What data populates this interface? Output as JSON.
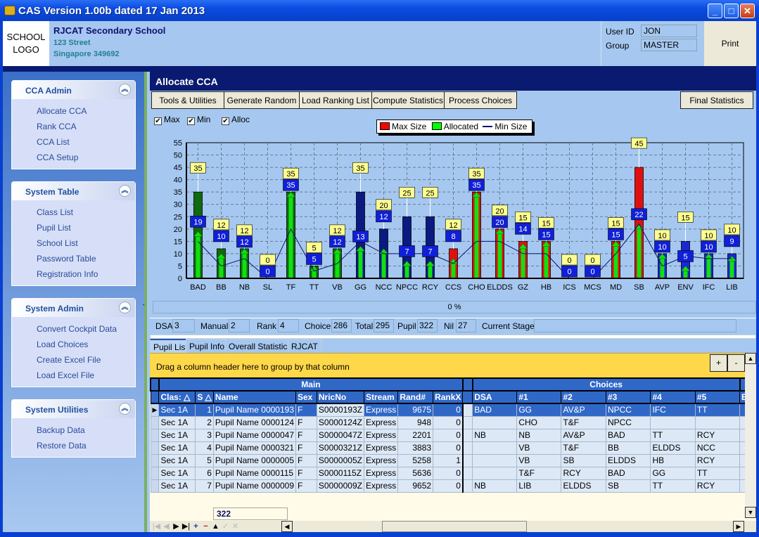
{
  "window": {
    "title": "CAS Version 1.00b dated 17 Jan 2013",
    "minimize": "_",
    "maximize": "□",
    "close": "✕"
  },
  "header": {
    "logo_line1": "SCHOOL",
    "logo_line2": "LOGO",
    "school_name": "RJCAT Secondary School",
    "address_line1": "123 Street",
    "address_line2": "Singapore 349692",
    "user_id_label": "User ID",
    "user_id": "JON",
    "group_label": "Group",
    "group": "MASTER",
    "print_label": "Print"
  },
  "sidebar": {
    "panels": [
      {
        "title": "CCA Admin",
        "items": [
          "Allocate CCA",
          "Rank CCA",
          "CCA List",
          "CCA Setup"
        ]
      },
      {
        "title": "System Table",
        "items": [
          "Class List",
          "Pupil List",
          "School List",
          "Password Table",
          "Registration Info"
        ]
      },
      {
        "title": "System Admin",
        "items": [
          "Convert Cockpit Data",
          "Load Choices",
          "Create Excel File",
          "Load Excel File"
        ]
      },
      {
        "title": "System Utilities",
        "items": [
          "Backup Data",
          "Restore Data"
        ]
      }
    ],
    "toggle_icon": "double-chevron-up-icon"
  },
  "main": {
    "title": "Allocate CCA",
    "toolbar": [
      "Tools & Utilities",
      "Generate Random",
      "Load Ranking List",
      "Compute Statistics",
      "Process Choices"
    ],
    "final_stats": "Final Statistics",
    "checkboxes": [
      {
        "label": "Max",
        "checked": true
      },
      {
        "label": "Min",
        "checked": true
      },
      {
        "label": "Alloc",
        "checked": true
      }
    ],
    "progress_text": "0 %",
    "progress": 0,
    "stats": {
      "dsa_label": "DSA",
      "dsa": "3",
      "manual_label": "Manual",
      "manual": "2",
      "rank_label": "Rank",
      "rank": "4",
      "choice_label": "Choice",
      "choice": "286",
      "total_label": "Total",
      "total": "295",
      "pupil_label": "Pupil",
      "pupil": "322",
      "nil_label": "Nil",
      "nil": "27",
      "stage_label": "Current Stage",
      "stage": ""
    },
    "tabs": [
      "Pupil List",
      "Pupil Info",
      "Overall Statistics",
      "RJCAT"
    ],
    "active_tab": 0,
    "group_hint": "Drag a column header here to group by that column",
    "plus": "+",
    "minus": "-"
  },
  "chart_data": {
    "type": "bar",
    "legend": [
      {
        "name": "Max Size",
        "color": "#ff0000"
      },
      {
        "name": "Allocated",
        "color": "#00ff00"
      },
      {
        "name": "Min Size",
        "color": "#101070"
      }
    ],
    "legend_position": "top-center",
    "categories": [
      "BAD",
      "BB",
      "NB",
      "SL",
      "TF",
      "TT",
      "VB",
      "GG",
      "NCC",
      "NPCC",
      "RCY",
      "CCS",
      "CHO",
      "ELDDS",
      "GZ",
      "HB",
      "ICS",
      "MCS",
      "MD",
      "SB",
      "AVP",
      "ENV",
      "IFC",
      "LIB"
    ],
    "series": [
      {
        "name": "Max Size",
        "values": [
          35,
          12,
          12,
          0,
          35,
          5,
          12,
          35,
          20,
          25,
          25,
          12,
          35,
          20,
          15,
          15,
          0,
          0,
          15,
          45,
          10,
          15,
          10,
          10
        ]
      },
      {
        "name": "Allocated",
        "values": [
          19,
          10,
          12,
          0,
          35,
          5,
          12,
          13,
          12,
          7,
          7,
          8,
          35,
          20,
          14,
          15,
          0,
          0,
          15,
          22,
          10,
          5,
          10,
          9
        ]
      },
      {
        "name": "Min Size",
        "values": [
          15,
          5,
          8,
          0,
          20,
          3,
          6,
          15,
          10,
          10,
          10,
          6,
          15,
          15,
          10,
          10,
          0,
          0,
          10,
          22,
          5,
          9,
          8,
          8
        ]
      }
    ],
    "bar_colors": [
      "#106a10",
      "#106a10",
      "#106a10",
      "#106a10",
      "#106a10",
      "#106a10",
      "#106a10",
      "#0a1a80",
      "#0a1a80",
      "#0a1a80",
      "#0a1a80",
      "#e01010",
      "#e01010",
      "#e01010",
      "#e01010",
      "#e01010",
      "#e01010",
      "#e01010",
      "#e01010",
      "#e01010",
      "#1a28d0",
      "#1a28d0",
      "#1a28d0",
      "#1a28d0"
    ],
    "ylim": [
      0,
      55
    ],
    "yticks": [
      0,
      5,
      10,
      15,
      20,
      25,
      30,
      35,
      40,
      45,
      50,
      55
    ],
    "grid": true,
    "title": "",
    "xlabel": "",
    "ylabel": ""
  },
  "grid": {
    "bands": [
      "Main",
      "Choices"
    ],
    "columns": [
      "Clas: △",
      "S △",
      "Name",
      "Sex",
      "NricNo",
      "Stream",
      "Rand#",
      "RankX",
      "DSA",
      "#1",
      "#2",
      "#3",
      "#4",
      "#5",
      "BA"
    ],
    "rows": [
      [
        "Sec 1A",
        "1",
        "Pupil Name 0000193",
        "F",
        "S0000193Z",
        "Express",
        "9675",
        "0",
        "BAD",
        "GG",
        "AV&P",
        "NPCC",
        "IFC",
        "TT"
      ],
      [
        "Sec 1A",
        "2",
        "Pupil Name 0000124",
        "F",
        "S0000124Z",
        "Express",
        "948",
        "0",
        "",
        "CHO",
        "T&F",
        "NPCC",
        "",
        ""
      ],
      [
        "Sec 1A",
        "3",
        "Pupil Name 0000047",
        "F",
        "S0000047Z",
        "Express",
        "2201",
        "0",
        "NB",
        "NB",
        "AV&P",
        "BAD",
        "TT",
        "RCY"
      ],
      [
        "Sec 1A",
        "4",
        "Pupil Name 0000321",
        "F",
        "S0000321Z",
        "Express",
        "3883",
        "0",
        "",
        "VB",
        "T&F",
        "BB",
        "ELDDS",
        "NCC"
      ],
      [
        "Sec 1A",
        "5",
        "Pupil Name 0000005",
        "F",
        "S0000005Z",
        "Express",
        "5258",
        "1",
        "",
        "VB",
        "SB",
        "ELDDS",
        "HB",
        "RCY"
      ],
      [
        "Sec 1A",
        "6",
        "Pupil Name 0000115",
        "F",
        "S0000115Z",
        "Express",
        "5636",
        "0",
        "",
        "T&F",
        "RCY",
        "BAD",
        "GG",
        "TT"
      ],
      [
        "Sec 1A",
        "7",
        "Pupil Name 0000009",
        "F",
        "S0000009Z",
        "Express",
        "9652",
        "0",
        "NB",
        "LIB",
        "ELDDS",
        "SB",
        "TT",
        "RCY"
      ]
    ],
    "selected_row": 0,
    "footer_count": "322"
  },
  "navigator": [
    "|◀",
    "◀",
    "▶",
    "▶|",
    "+",
    "−",
    "▲",
    "✓",
    "✕"
  ]
}
